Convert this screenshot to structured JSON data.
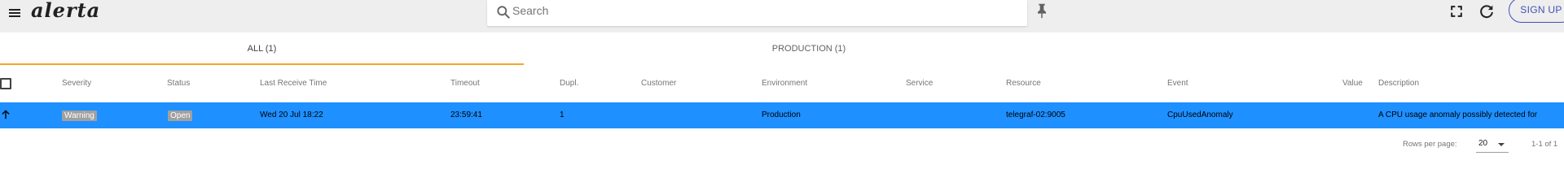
{
  "app": {
    "logo_text": "alerta"
  },
  "header": {
    "search": {
      "placeholder": "Search",
      "value": ""
    },
    "signup_label": "SIGN UP",
    "icons": [
      "menu-icon",
      "search-icon",
      "pin-icon",
      "fullscreen-icon",
      "refresh-icon"
    ]
  },
  "tabs": [
    {
      "label": "ALL (1)",
      "active": true
    },
    {
      "label": "PRODUCTION (1)",
      "active": false
    }
  ],
  "table": {
    "columns": [
      "Severity",
      "Status",
      "Last Receive Time",
      "Timeout",
      "Dupl.",
      "Customer",
      "Environment",
      "Service",
      "Resource",
      "Event",
      "Value",
      "Description"
    ],
    "rows": [
      {
        "trend_icon": "arrow-up-icon",
        "severity": "Warning",
        "status": "Open",
        "last_receive_time": "Wed 20 Jul 18:22",
        "timeout": "23:59:41",
        "duplicates": "1",
        "customer": "",
        "environment": "Production",
        "service": "",
        "resource": "telegraf-02:9005",
        "event": "CpuUsedAnomaly",
        "value": "",
        "description": "A CPU usage anomaly possibly detected for"
      }
    ]
  },
  "pagination": {
    "rows_per_page_label": "Rows per page:",
    "rows_per_page": "20",
    "range": "1-1 of 1"
  },
  "colors": {
    "topbar_bg": "#eeeeee",
    "accent": "#3f51b5",
    "tab_indicator": "#f5a623",
    "selected_row": "#1e90ff",
    "badge_bg": "#a0a0a0"
  }
}
